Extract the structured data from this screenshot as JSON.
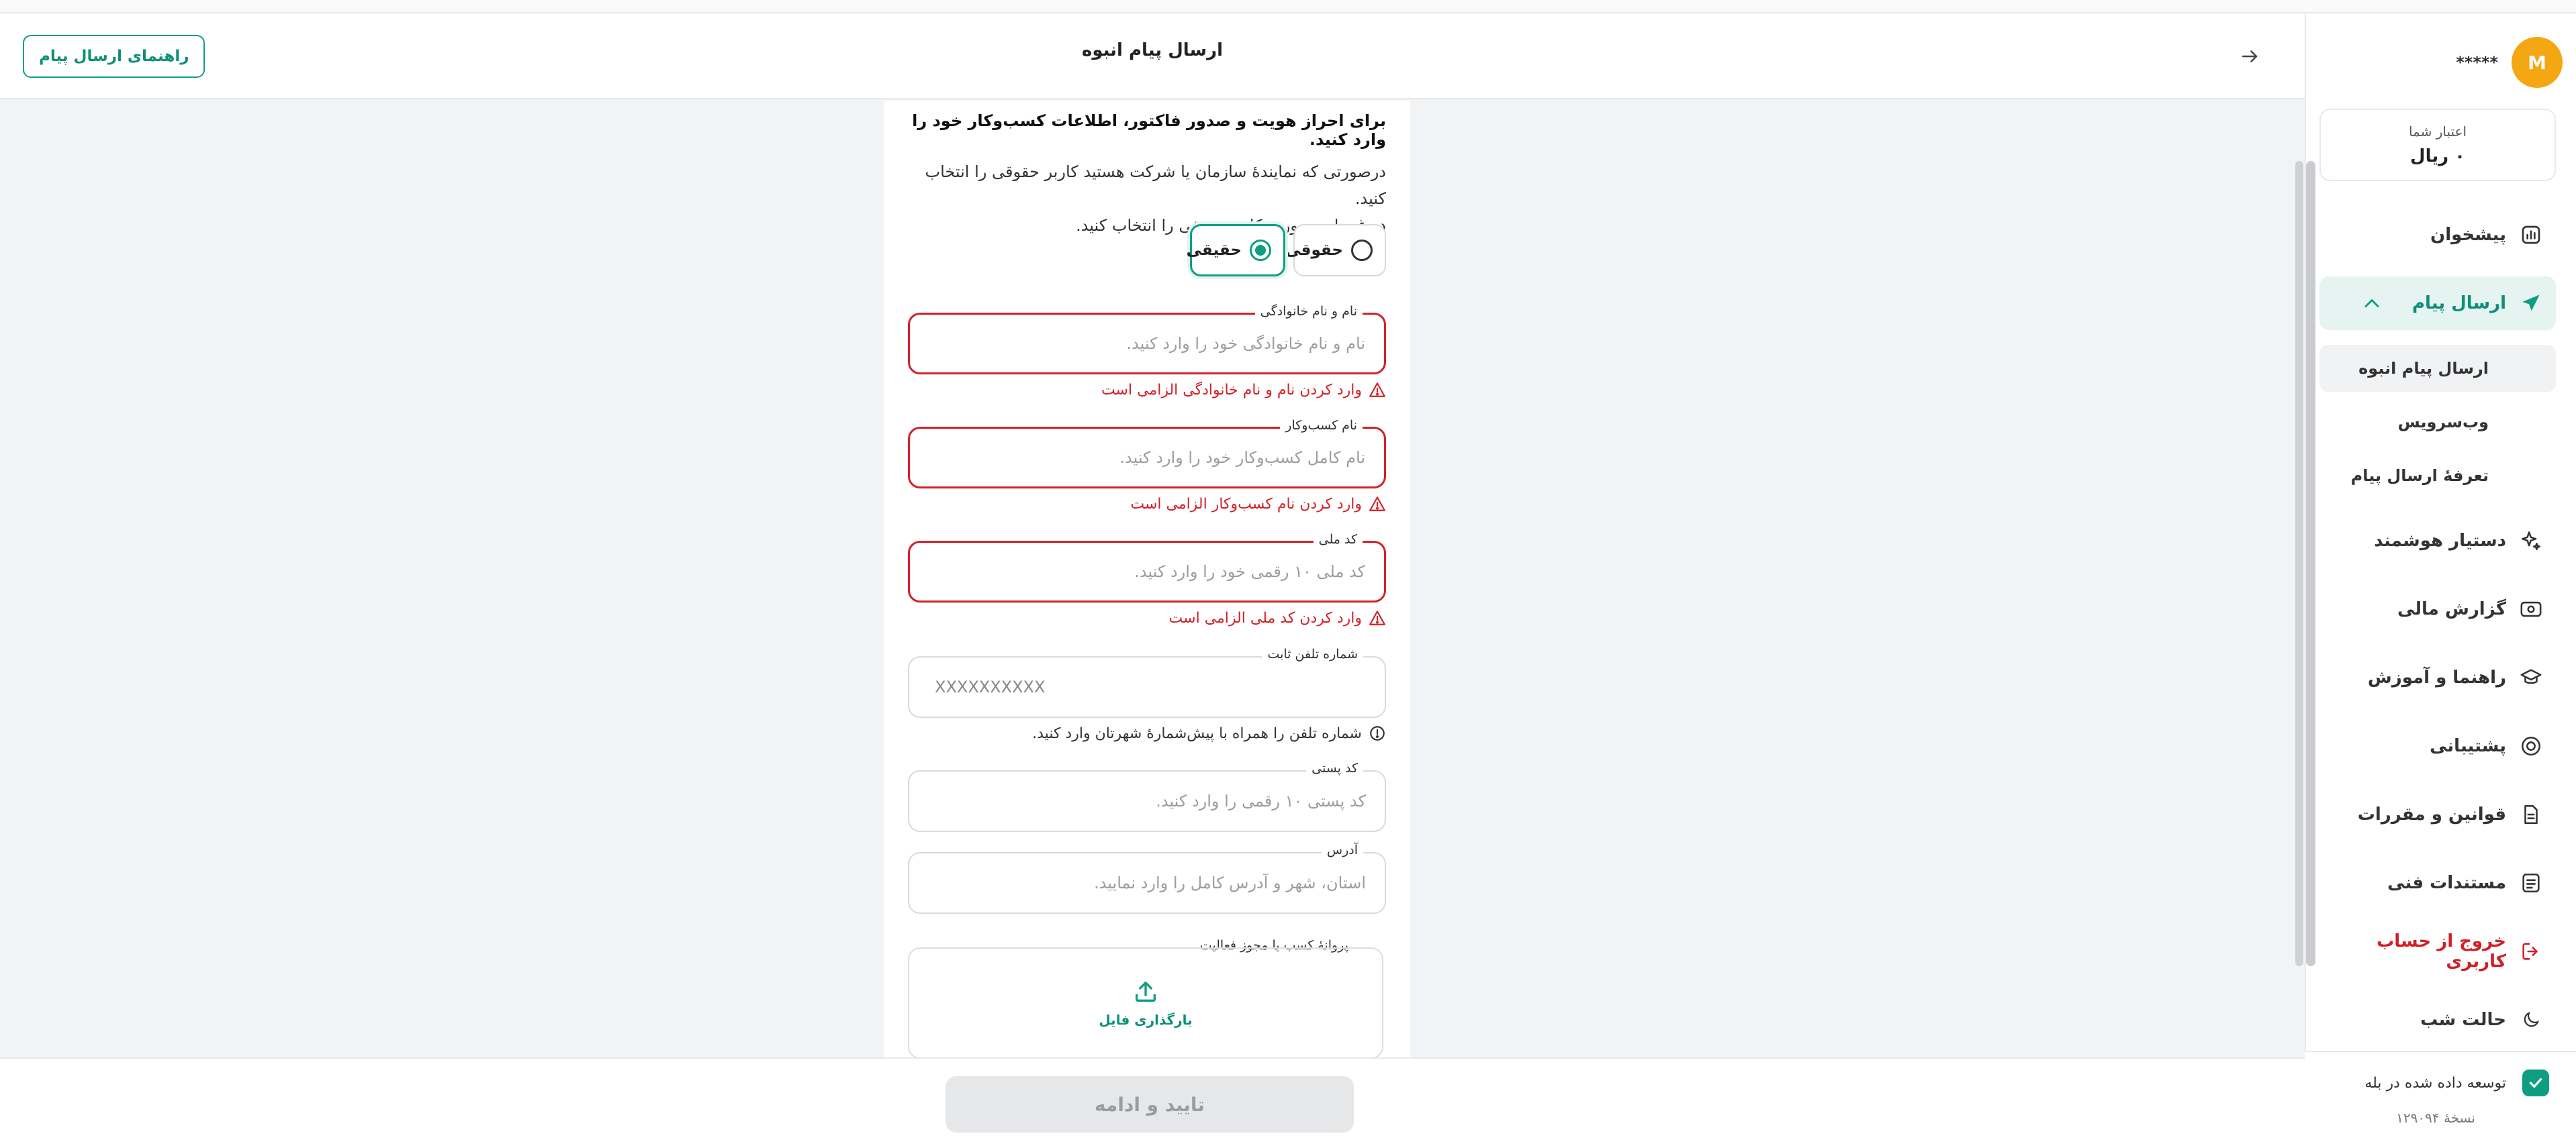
{
  "header": {
    "title": "ارسال پیام انبوه",
    "guide_button": "راهنمای ارسال پیام"
  },
  "user": {
    "avatar_letter": "M",
    "name": "*****"
  },
  "credit": {
    "label": "اعتبار شما",
    "value": "۰ ریال"
  },
  "sidebar": {
    "items": [
      {
        "label": "پیشخوان",
        "icon": "chart-icon"
      },
      {
        "label": "ارسال پیام",
        "icon": "send-icon",
        "active": true,
        "expanded": true
      },
      {
        "label": "دستیار هوشمند",
        "icon": "sparkle-icon"
      },
      {
        "label": "گزارش مالی",
        "icon": "money-icon"
      },
      {
        "label": "راهنما و آموزش",
        "icon": "graduation-cap-icon"
      },
      {
        "label": "پشتیبانی",
        "icon": "headset-icon"
      },
      {
        "label": "قوانین و مقررات",
        "icon": "document-icon"
      },
      {
        "label": "مستندات فنی",
        "icon": "list-document-icon"
      },
      {
        "label": "خروج از حساب کاربری",
        "icon": "logout-icon",
        "color": "#d32027"
      }
    ],
    "sub_items": [
      {
        "label": "ارسال پیام انبوه",
        "selected": true
      },
      {
        "label": "وب‌سرویس"
      },
      {
        "label": "تعرفهٔ ارسال پیام"
      }
    ],
    "dark_mode": {
      "label": "حالت شب",
      "icon": "moon-icon"
    },
    "developed_by": "توسعه داده شده در بله",
    "version": "نسخهٔ ۱۲۹۰۹۴"
  },
  "form": {
    "intro_title": "برای احراز هویت و صدور فاکتور، اطلاعات کسب‌وکار خود را وارد کنید.",
    "intro_line1": "درصورتی که نمایندهٔ سازمان یا شرکت هستید کاربر حقوقی را انتخاب کنید.",
    "intro_line2": "در غیر این صورت کاربر حقیقی را انتخاب کنید.",
    "radio_legal": "حقوقی",
    "radio_natural": "حقیقی",
    "selected_type": "حقیقی",
    "full_name": {
      "label": "نام و نام خانوادگی",
      "placeholder": "نام و نام خانوادگی خود را وارد کنید.",
      "value": "",
      "error": "وارد کردن نام و نام خانوادگی الزامی است"
    },
    "business_name": {
      "label": "نام کسب‌وکار",
      "placeholder": "نام کامل کسب‌وکار خود را وارد کنید.",
      "value": "",
      "error": "وارد کردن نام کسب‌وکار الزامی است"
    },
    "national_code": {
      "label": "کد ملی",
      "placeholder": "کد ملی ۱۰ رقمی خود را وارد کنید.",
      "value": "",
      "error": "وارد کردن کد ملی الزامی است"
    },
    "landline": {
      "label": "شماره تلفن ثابت",
      "placeholder": "XXXXXXXXXX",
      "value": "",
      "hint": "شماره تلفن را همراه با پیش‌شمارهٔ شهرتان وارد کنید."
    },
    "postal_code": {
      "label": "کد پستی",
      "placeholder": "کد پستی ۱۰ رقمی را وارد کنید.",
      "value": ""
    },
    "address": {
      "label": "آدرس",
      "placeholder": "استان، شهر و آدرس کامل را وارد نمایید.",
      "value": ""
    },
    "license": {
      "label": "پروانهٔ کسب یا مجوز فعالیت",
      "upload_text": "بارگذاری فایل"
    }
  },
  "footer": {
    "submit_label": "تایید و ادامه"
  },
  "colors": {
    "brand": "#0d9e82",
    "error": "#d32027",
    "avatar": "#f4a712"
  }
}
